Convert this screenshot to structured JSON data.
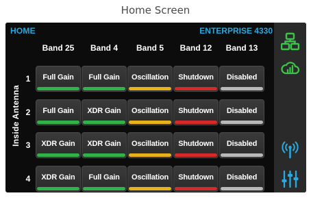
{
  "caption": "Home Screen",
  "header": {
    "home_label": "HOME",
    "model_label": "ENTERPRISE 4330"
  },
  "side_label": "Inside Antenna",
  "bands": [
    "Band 25",
    "Band 4",
    "Band 5",
    "Band 12",
    "Band 13"
  ],
  "rows": [
    {
      "number": "1",
      "cells": [
        {
          "text": "Full Gain",
          "status": "green"
        },
        {
          "text": "Full Gain",
          "status": "green"
        },
        {
          "text": "Oscillation",
          "status": "yellow"
        },
        {
          "text": "Shutdown",
          "status": "red"
        },
        {
          "text": "Disabled",
          "status": "gray"
        }
      ]
    },
    {
      "number": "2",
      "cells": [
        {
          "text": "Full Gain",
          "status": "green"
        },
        {
          "text": "XDR Gain",
          "status": "green"
        },
        {
          "text": "Oscillation",
          "status": "yellow"
        },
        {
          "text": "Shutdown",
          "status": "red"
        },
        {
          "text": "Disabled",
          "status": "gray"
        }
      ]
    },
    {
      "number": "3",
      "cells": [
        {
          "text": "XDR Gain",
          "status": "green"
        },
        {
          "text": "XDR Gain",
          "status": "green"
        },
        {
          "text": "Oscillation",
          "status": "yellow"
        },
        {
          "text": "Shutdown",
          "status": "red"
        },
        {
          "text": "Disabled",
          "status": "gray"
        }
      ]
    },
    {
      "number": "4",
      "cells": [
        {
          "text": "XDR Gain",
          "status": "green"
        },
        {
          "text": "Full Gain",
          "status": "green"
        },
        {
          "text": "Oscillation",
          "status": "yellow"
        },
        {
          "text": "Shutdown",
          "status": "red"
        },
        {
          "text": "Disabled",
          "status": "gray"
        }
      ]
    }
  ],
  "status_colors": {
    "green": "#2fb34a",
    "yellow": "#e8b21c",
    "red": "#d42a2a",
    "gray": "#b8b8b8"
  },
  "colors": {
    "accent_blue": "#2aa9e0",
    "icon_green": "#3cc34a",
    "icon_blue": "#2aa9e0"
  },
  "right_panel_icons": [
    "network-icon",
    "cloud-signal-icon",
    "antenna-icon",
    "settings-sliders-icon"
  ]
}
